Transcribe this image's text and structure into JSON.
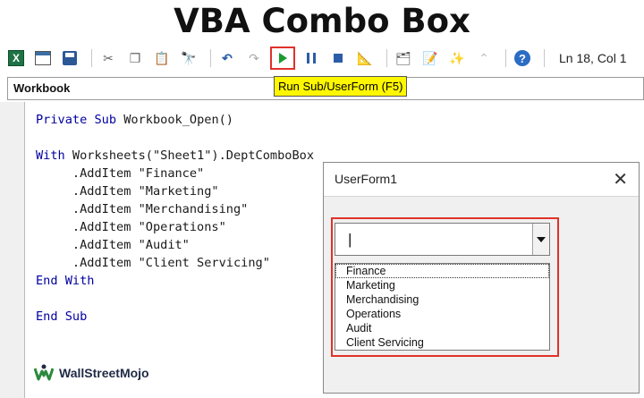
{
  "header": {
    "title": "VBA Combo Box"
  },
  "toolbar": {
    "status": "Ln 18, Col 1",
    "tooltip": "Run Sub/UserForm (F5)",
    "icons": [
      "excel-icon",
      "insert-userform-icon",
      "save-icon",
      "cut-icon",
      "copy-icon",
      "paste-icon",
      "find-icon",
      "undo-icon",
      "redo-icon",
      "run-icon",
      "break-icon",
      "reset-icon",
      "design-mode-icon",
      "project-explorer-icon",
      "properties-icon",
      "object-browser-icon",
      "toolbox-icon",
      "help-icon"
    ]
  },
  "object_box": {
    "value": "Workbook"
  },
  "code": {
    "lines": [
      "Private Sub Workbook_Open()",
      "",
      "With Worksheets(\"Sheet1\").DeptComboBox",
      "     .AddItem \"Finance\"",
      "     .AddItem \"Marketing\"",
      "     .AddItem \"Merchandising\"",
      "     .AddItem \"Operations\"",
      "     .AddItem \"Audit\"",
      "     .AddItem \"Client Servicing\"",
      "End With",
      "",
      "End Sub"
    ]
  },
  "userform": {
    "title": "UserForm1",
    "combo_value": "|",
    "items": [
      "Finance",
      "Marketing",
      "Merchandising",
      "Operations",
      "Audit",
      "Client Servicing"
    ]
  },
  "branding": {
    "logo_text": "WallStreetMojo"
  },
  "colors": {
    "highlight": "#e0322a",
    "tooltip": "#fff700",
    "run_green": "#1a9b2f"
  }
}
